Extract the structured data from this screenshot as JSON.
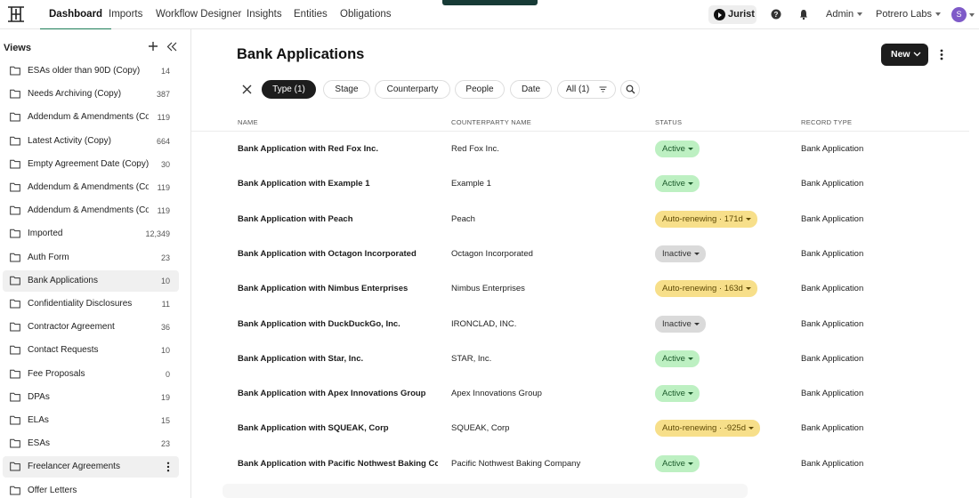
{
  "nav": {
    "tabs": [
      "Dashboard",
      "Imports",
      "Workflow Designer",
      "Insights",
      "Entities",
      "Obligations"
    ],
    "active_tab": "Dashboard",
    "jurist_label": "Jurist",
    "admin_label": "Admin",
    "org_label": "Potrero Labs",
    "avatar_initial": "S"
  },
  "sidebar": {
    "title": "Views",
    "items": [
      {
        "label": "ESAs older than 90D (Copy)",
        "count": "14"
      },
      {
        "label": "Needs Archiving (Copy)",
        "count": "387"
      },
      {
        "label": "Addendum & Amendments (Co",
        "count": "119"
      },
      {
        "label": "Latest Activity (Copy)",
        "count": "664"
      },
      {
        "label": "Empty Agreement Date (Copy)",
        "count": "30"
      },
      {
        "label": "Addendum & Amendments (Co",
        "count": "119"
      },
      {
        "label": "Addendum & Amendments (Co",
        "count": "119"
      },
      {
        "label": "Imported",
        "count": "12,349"
      },
      {
        "label": "Auth Form",
        "count": "23"
      },
      {
        "label": "Bank Applications",
        "count": "10"
      },
      {
        "label": "Confidentiality Disclosures",
        "count": "11"
      },
      {
        "label": "Contractor Agreement",
        "count": "36"
      },
      {
        "label": "Contact Requests",
        "count": "10"
      },
      {
        "label": "Fee Proposals",
        "count": "0"
      },
      {
        "label": "DPAs",
        "count": "19"
      },
      {
        "label": "ELAs",
        "count": "15"
      },
      {
        "label": "ESAs",
        "count": "23"
      },
      {
        "label": "Freelancer Agreements",
        "count": ""
      },
      {
        "label": "Offer Letters",
        "count": ""
      }
    ]
  },
  "main": {
    "title": "Bank Applications",
    "new_label": "New",
    "filters": [
      "Type (1)",
      "Stage",
      "Counterparty",
      "People",
      "Date",
      "All (1)"
    ],
    "columns": [
      "NAME",
      "COUNTERPARTY NAME",
      "STATUS",
      "RECORD TYPE"
    ],
    "rows": [
      {
        "name": "Bank Application with Red Fox Inc.",
        "counterparty": "Red Fox Inc.",
        "status": "Active",
        "status_kind": "active",
        "record_type": "Bank Application"
      },
      {
        "name": "Bank Application with Example 1",
        "counterparty": "Example 1",
        "status": "Active",
        "status_kind": "active",
        "record_type": "Bank Application"
      },
      {
        "name": "Bank Application with Peach",
        "counterparty": "Peach",
        "status": "Auto-renewing · 171d",
        "status_kind": "auto",
        "record_type": "Bank Application"
      },
      {
        "name": "Bank Application with Octagon Incorporated",
        "counterparty": "Octagon Incorporated",
        "status": "Inactive",
        "status_kind": "inactive",
        "record_type": "Bank Application"
      },
      {
        "name": "Bank Application with Nimbus Enterprises",
        "counterparty": "Nimbus Enterprises",
        "status": "Auto-renewing · 163d",
        "status_kind": "auto",
        "record_type": "Bank Application"
      },
      {
        "name": "Bank Application with DuckDuckGo, Inc.",
        "counterparty": "IRONCLAD, INC.",
        "status": "Inactive",
        "status_kind": "inactive",
        "record_type": "Bank Application"
      },
      {
        "name": "Bank Application with Star, Inc.",
        "counterparty": "STAR, Inc.",
        "status": "Active",
        "status_kind": "active",
        "record_type": "Bank Application"
      },
      {
        "name": "Bank Application with Apex Innovations Group",
        "counterparty": "Apex Innovations Group",
        "status": "Active",
        "status_kind": "active",
        "record_type": "Bank Application"
      },
      {
        "name": "Bank Application with SQUEAK, Corp",
        "counterparty": "SQUEAK, Corp",
        "status": "Auto-renewing · -925d",
        "status_kind": "auto",
        "record_type": "Bank Application"
      },
      {
        "name": "Bank Application with Pacific Nothwest Baking Con",
        "counterparty": "Pacific Nothwest Baking Company",
        "status": "Active",
        "status_kind": "active",
        "record_type": "Bank Application"
      }
    ]
  },
  "colors": {
    "accent": "#1d7d57",
    "active_bg": "#bdf0c2",
    "auto_bg": "#f7df8a",
    "inactive_bg": "#dadada",
    "avatar": "#7e5ac8"
  },
  "icons": [
    "app-logo-icon",
    "help-icon",
    "bell-icon",
    "plus-icon",
    "collapse-icon",
    "folder-icon",
    "close-icon",
    "filter-icon",
    "search-icon",
    "chevron-down-icon",
    "kebab-icon",
    "cursor-icon"
  ]
}
